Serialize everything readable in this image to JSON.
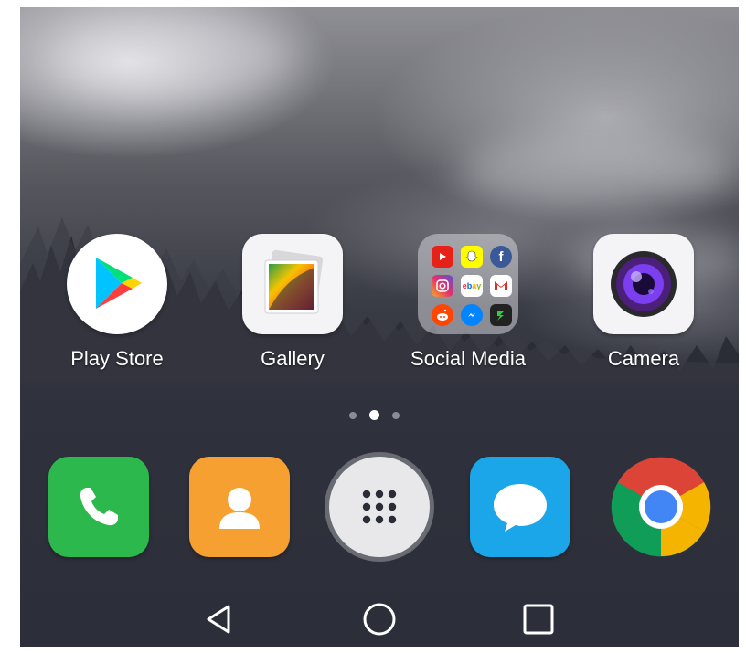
{
  "home_apps": [
    {
      "label": "Play Store",
      "icon": "play-store-icon"
    },
    {
      "label": "Gallery",
      "icon": "gallery-icon"
    },
    {
      "label": "Social Media",
      "icon": "social-media-folder-icon"
    },
    {
      "label": "Camera",
      "icon": "camera-icon"
    }
  ],
  "folder_apps": [
    {
      "icon": "youtube-icon",
      "color": "#e62117"
    },
    {
      "icon": "snapchat-icon",
      "color": "#fffc00"
    },
    {
      "icon": "facebook-icon",
      "color": "#3b5998"
    },
    {
      "icon": "instagram-icon",
      "color": "#c13584"
    },
    {
      "icon": "ebay-icon",
      "color": "#ffffff"
    },
    {
      "icon": "gmail-icon",
      "color": "#ffffff"
    },
    {
      "icon": "reddit-icon",
      "color": "#ff4500"
    },
    {
      "icon": "messenger-icon",
      "color": "#0084ff"
    },
    {
      "icon": "deals-icon",
      "color": "#222222"
    }
  ],
  "page_indicator": {
    "pages": 3,
    "current": 2
  },
  "dock": [
    {
      "icon": "phone-icon",
      "color": "#2db84d"
    },
    {
      "icon": "contacts-icon",
      "color": "#f5a030"
    },
    {
      "icon": "app-drawer-icon",
      "color": "#e8e8ea"
    },
    {
      "icon": "messages-icon",
      "color": "#1aa6e8"
    },
    {
      "icon": "chrome-icon",
      "color": "#ffffff"
    }
  ],
  "nav_buttons": [
    "back-icon",
    "home-icon",
    "recents-icon"
  ]
}
